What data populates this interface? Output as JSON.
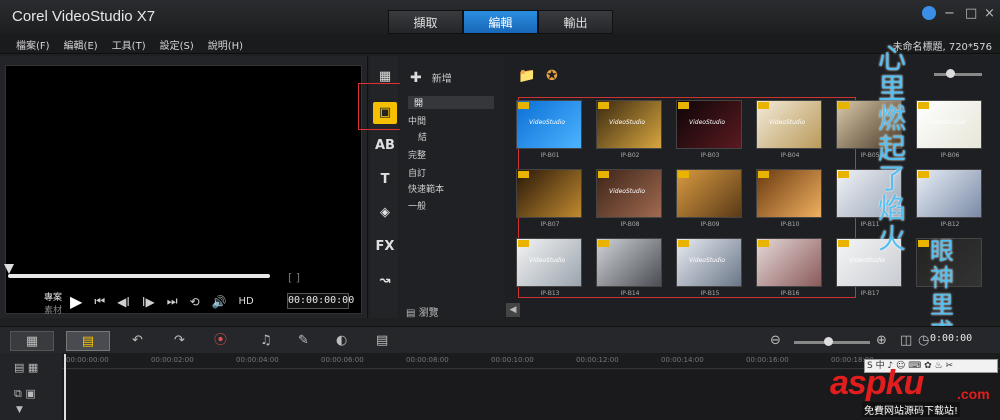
{
  "app": {
    "title": "Corel VideoStudio X7"
  },
  "tabs": [
    {
      "label": "擷取",
      "active": false
    },
    {
      "label": "編輯",
      "active": true
    },
    {
      "label": "輸出",
      "active": false
    }
  ],
  "window_controls": {
    "minimize": "−",
    "maximize": "□",
    "close": "×"
  },
  "menubar": {
    "items": [
      "檔案(F)",
      "編輯(E)",
      "工具(T)",
      "設定(S)",
      "說明(H)"
    ],
    "project_title": "未命名標題, 720*576"
  },
  "preview": {
    "mode_project": "專案",
    "mode_clip": "素材",
    "transport": [
      "▶",
      "⏮",
      "◀Ⅰ",
      "Ⅰ▶",
      "⏭",
      "⟲",
      "🔊"
    ],
    "hd_label": "HD",
    "timecode": "00:00:00:00",
    "trim_brackets": "[   ]"
  },
  "library_toolbar": {
    "buttons": [
      {
        "icon": "media-icon",
        "glyph": "▦"
      },
      {
        "icon": "instant-project-icon",
        "glyph": "▣"
      },
      {
        "icon": "transition-icon",
        "glyph": "AB"
      },
      {
        "icon": "title-icon",
        "glyph": "T"
      },
      {
        "icon": "graphic-icon",
        "glyph": "◈"
      },
      {
        "icon": "filter-icon",
        "glyph": "FX"
      },
      {
        "icon": "path-icon",
        "glyph": "↝"
      }
    ]
  },
  "categories": {
    "add_label": "新增",
    "items": [
      "開",
      "中間",
      "結",
      "完整",
      "自訂",
      "快速範本",
      "一般"
    ],
    "browse_label": "瀏覽"
  },
  "thumbnails": [
    {
      "label": "IP-B01",
      "caption": "VideoStudio",
      "colors": [
        "#0c6fd6",
        "#4bb4ff"
      ]
    },
    {
      "label": "IP-B02",
      "caption": "VideoStudio",
      "colors": [
        "#3a2a10",
        "#d8a640"
      ]
    },
    {
      "label": "IP-B03",
      "caption": "VideoStudio",
      "colors": [
        "#0d0507",
        "#5a1a20"
      ]
    },
    {
      "label": "IP-B04",
      "caption": "VideoStudio",
      "colors": [
        "#f2ead8",
        "#b99a5a"
      ]
    },
    {
      "label": "IP-B05",
      "caption": "",
      "colors": [
        "#d9c8a8",
        "#4a3a28"
      ]
    },
    {
      "label": "IP-B06",
      "caption": "VideoStudio",
      "colors": [
        "#ffffff",
        "#e6e6d8"
      ]
    },
    {
      "label": "IP-B07",
      "caption": "",
      "colors": [
        "#2a1808",
        "#c08a30"
      ]
    },
    {
      "label": "IP-B08",
      "caption": "VideoStudio",
      "colors": [
        "#3d2418",
        "#a06a50"
      ]
    },
    {
      "label": "IP-B09",
      "caption": "",
      "colors": [
        "#d89a40",
        "#5a3a18"
      ]
    },
    {
      "label": "IP-B10",
      "caption": "",
      "colors": [
        "#6a3a10",
        "#f0b060"
      ]
    },
    {
      "label": "IP-B11",
      "caption": "",
      "colors": [
        "#f0f2f6",
        "#9aa6b8"
      ]
    },
    {
      "label": "IP-B12",
      "caption": "",
      "colors": [
        "#e8eef6",
        "#7a8aa6"
      ]
    },
    {
      "label": "IP-B13",
      "caption": "VideoStudio",
      "colors": [
        "#f4f4f4",
        "#9aa4ae"
      ]
    },
    {
      "label": "IP-B14",
      "caption": "",
      "colors": [
        "#cfd2d6",
        "#4a4e54"
      ]
    },
    {
      "label": "IP-B15",
      "caption": "VideoStudio",
      "colors": [
        "#e8ecf2",
        "#6a7688"
      ]
    },
    {
      "label": "IP-B16",
      "caption": "",
      "colors": [
        "#e6d8d8",
        "#8a5a5a"
      ]
    },
    {
      "label": "IP-B17",
      "caption": "VideoStudio",
      "colors": [
        "#f6f6f6",
        "#c8ccd2"
      ]
    },
    {
      "label": "",
      "caption": "",
      "colors": [
        "#222",
        "#333"
      ]
    }
  ],
  "timeline": {
    "ruler_labels": [
      "00:00:00:00",
      "00:00:02:00",
      "00:00:04:00",
      "00:00:06:00",
      "00:00:08:00",
      "00:00:10:00",
      "00:00:12:00",
      "00:00:14:00",
      "00:00:16:00",
      "00:00:18:00"
    ],
    "timecode": "0:00:00",
    "tool_glyphs": [
      "↶",
      "↷",
      "⦿",
      "♫",
      "✎",
      "◐",
      "▤"
    ]
  },
  "overlay": {
    "poem_1": "心里燃起了焰火",
    "poem_2": "眼神里求知"
  },
  "watermark": {
    "brand": "aspku",
    "tld": ".com",
    "subtitle": "免費网站源码下载站!",
    "ime": "S 中 ♪ ☺ ⌨ ✿ ♨ ✂"
  },
  "colors": {
    "accent_blue": "#2b8ee0",
    "active_tool": "#f6c000",
    "highlight_red": "#e03030",
    "watermark_red": "#e21d1d"
  }
}
